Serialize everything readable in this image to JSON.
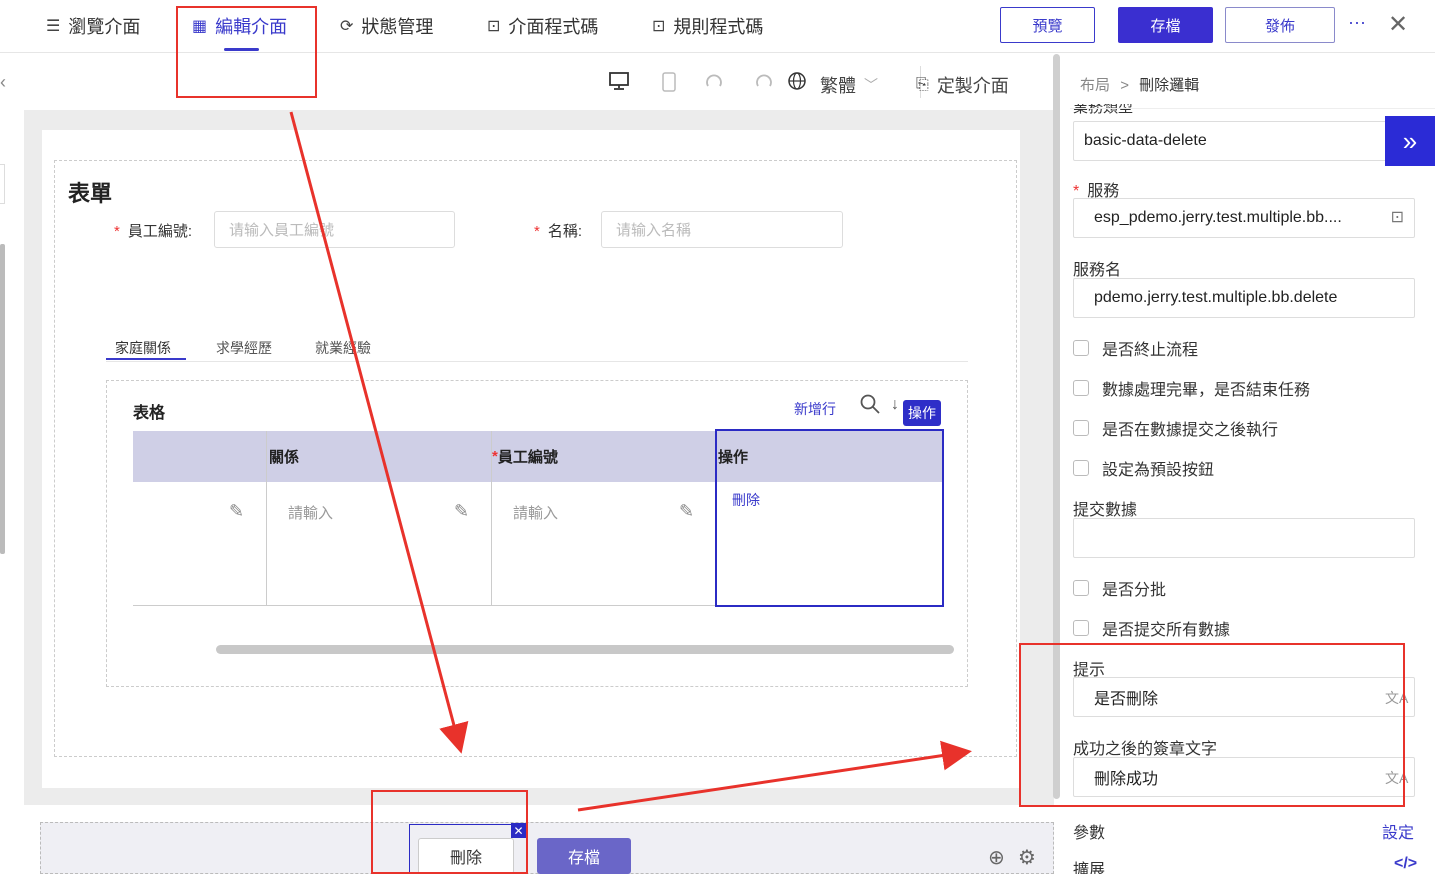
{
  "topbar": {
    "tabs": [
      {
        "icon": "list-icon",
        "glyph": "☰",
        "label": "瀏覽介面"
      },
      {
        "icon": "table-grid-icon",
        "glyph": "▦",
        "label": "編輯介面"
      },
      {
        "icon": "refresh-icon",
        "glyph": "⟳",
        "label": "狀態管理"
      },
      {
        "icon": "code-terminal-icon",
        "glyph": "⊡",
        "label": "介面程式碼"
      },
      {
        "icon": "code-terminal-icon",
        "glyph": "⊡",
        "label": "規則程式碼"
      }
    ],
    "preview_label": "預覽",
    "save_label": "存檔",
    "publish_label": "發佈",
    "more_glyph": "···",
    "close_glyph": "✕"
  },
  "canvas_toolbar": {
    "language": "繁體",
    "customize_label": "定製介面"
  },
  "form": {
    "title": "表單",
    "fields": [
      {
        "label": "員工編號:",
        "placeholder": "请输入員工編號"
      },
      {
        "label": "名稱:",
        "placeholder": "请输入名稱"
      }
    ],
    "tabs": [
      "家庭關係",
      "求學經歷",
      "就業經驗"
    ],
    "table": {
      "title": "表格",
      "add_row": "新增行",
      "op_tag": "操作",
      "headers": [
        "",
        "關係",
        "員工編號",
        "操作"
      ],
      "required_marker": "*",
      "cell_placeholder": "請輸入",
      "delete_link": "刪除"
    }
  },
  "bottom_bar": {
    "delete_label": "刪除",
    "save_label": "存檔"
  },
  "right_panel": {
    "breadcrumb_parent": "布局",
    "breadcrumb_sep": ">",
    "breadcrumb_current": "刪除邏輯",
    "cut_label": "業務類型",
    "business_type": "basic-data-delete",
    "service_label": "服務",
    "service_value": "esp_pdemo.jerry.test.multiple.bb....",
    "service_name_label": "服務名",
    "service_name_value": "pdemo.jerry.test.multiple.bb.delete",
    "checks_a": [
      "是否終止流程",
      "數據處理完畢，是否結束任務",
      "是否在數據提交之後執行",
      "設定為預設按鈕"
    ],
    "submit_data_label": "提交數據",
    "checks_b": [
      "是否分批",
      "是否提交所有數據"
    ],
    "tip_label": "提示",
    "tip_value": "是否刪除",
    "success_label": "成功之後的簽章文字",
    "success_value": "刪除成功",
    "params_label": "參數",
    "params_link": "設定",
    "extend_label": "擴展",
    "extend_link": "</>"
  },
  "colors": {
    "accent": "#3a3acb",
    "annotation": "#e8322b"
  }
}
